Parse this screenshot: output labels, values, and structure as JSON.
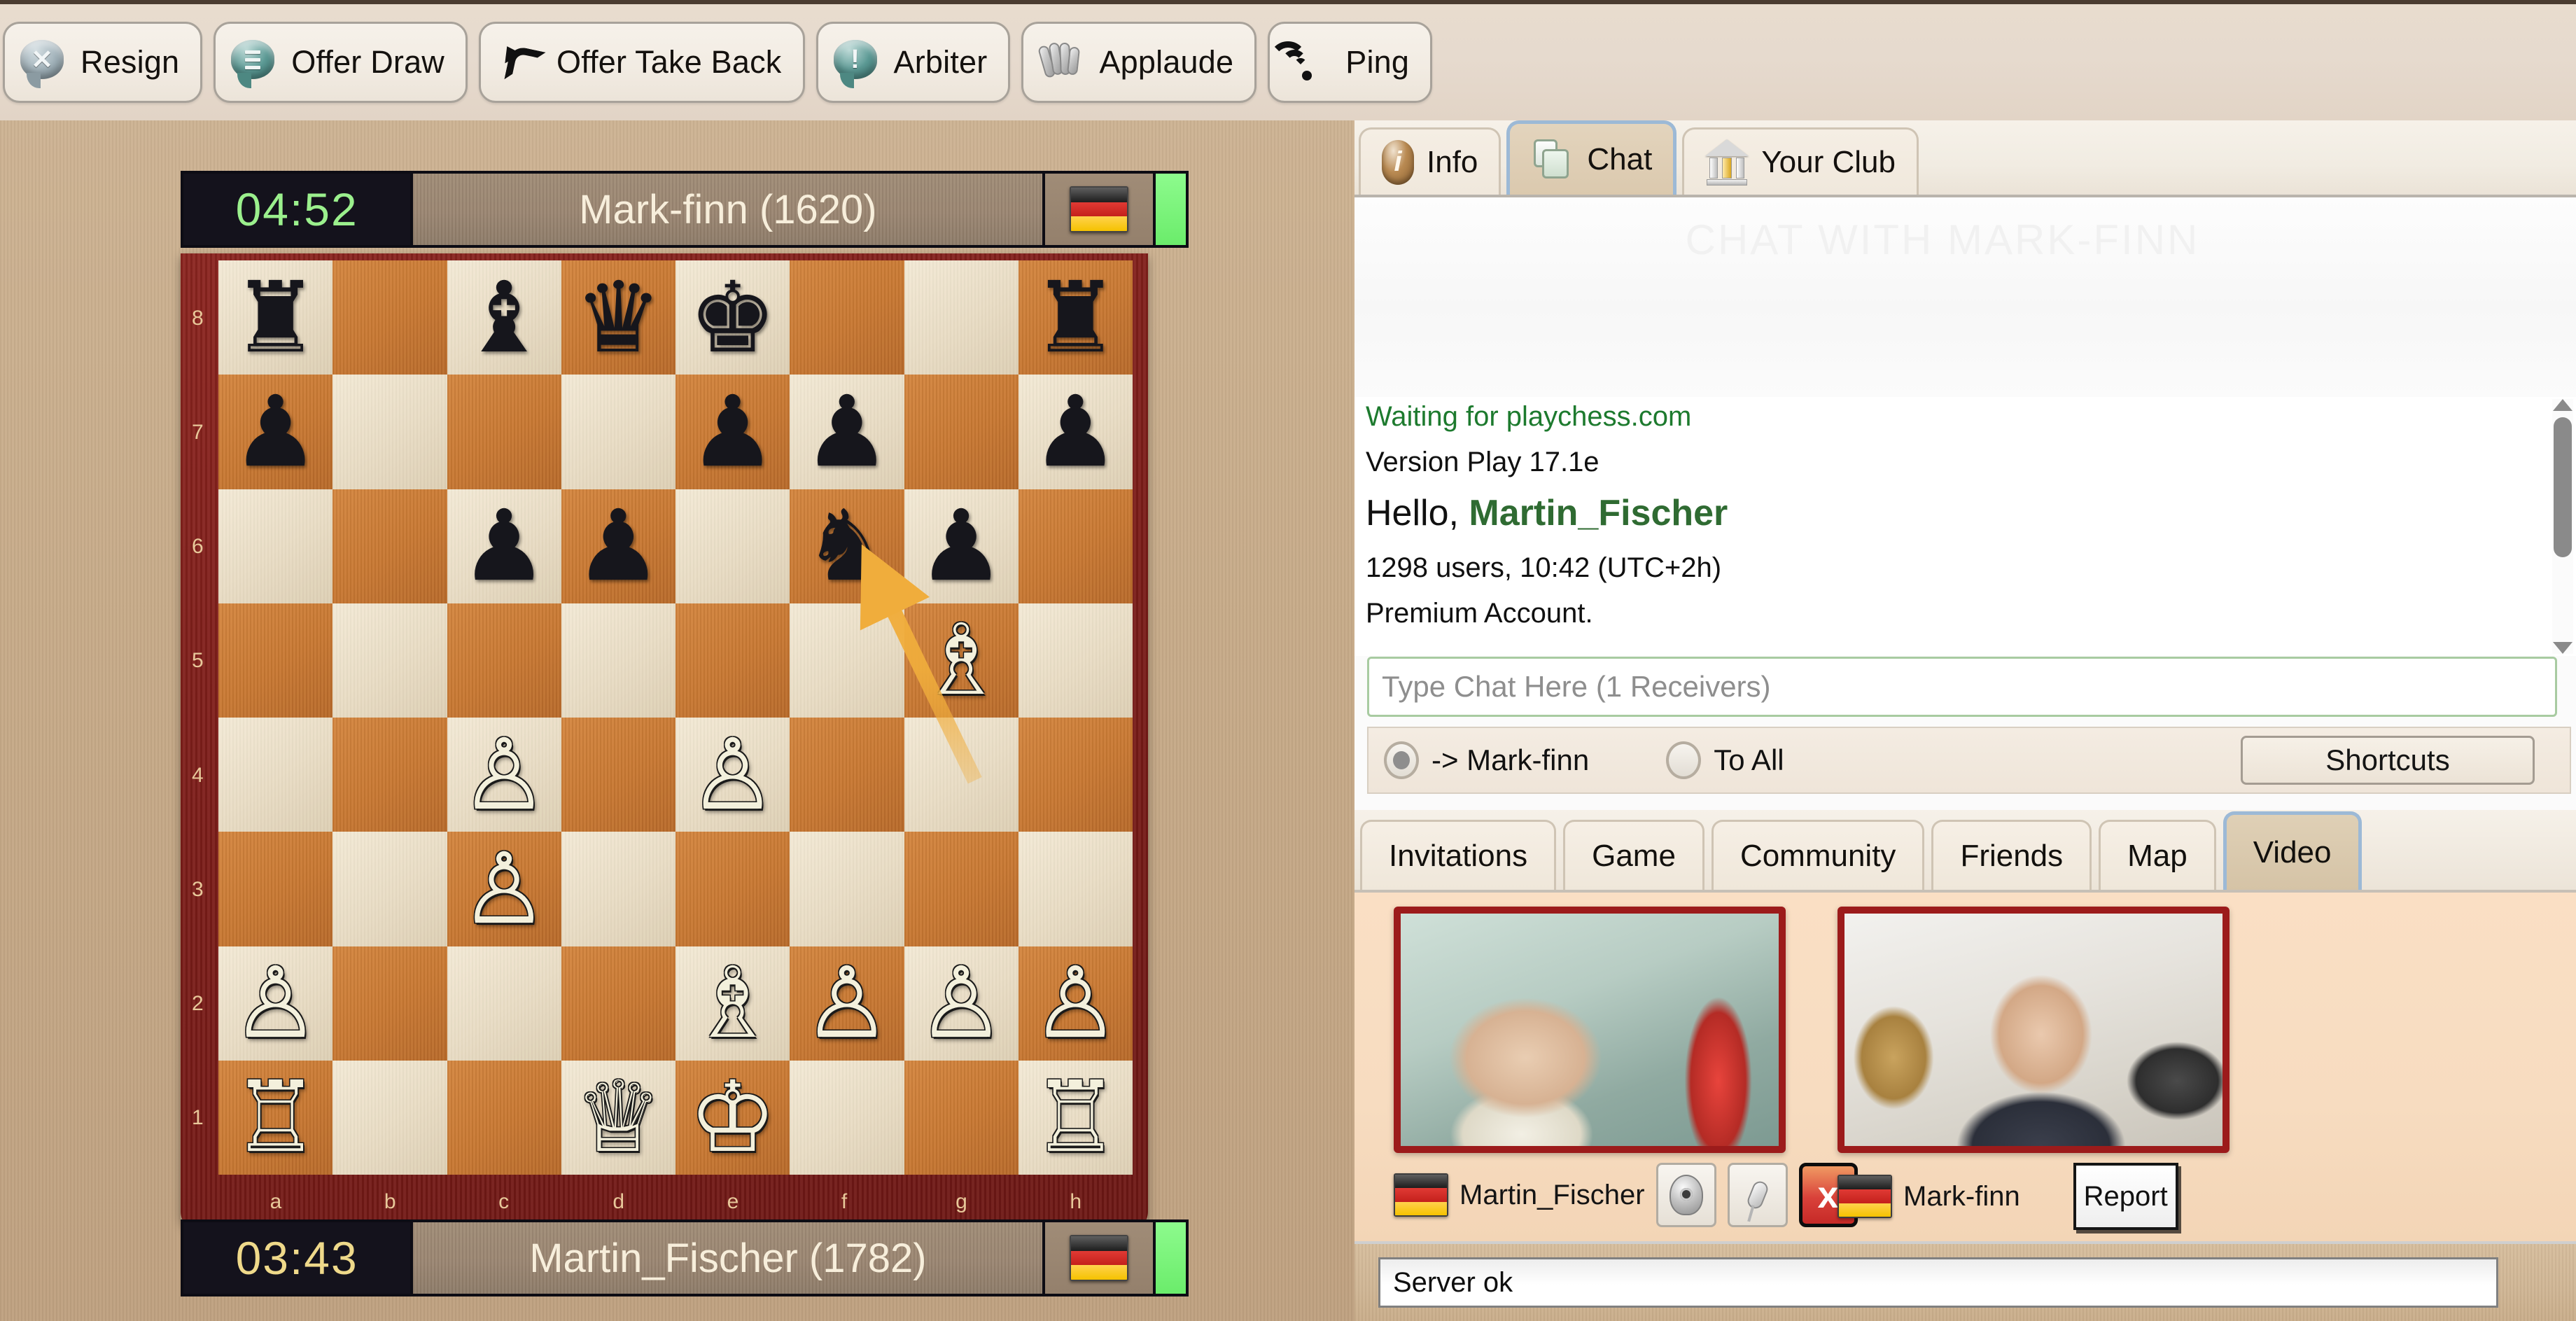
{
  "toolbar": {
    "buttons": [
      {
        "label": "Resign",
        "icon": "resign-bubble-icon"
      },
      {
        "label": "Offer Draw",
        "icon": "offer-draw-bubble-icon"
      },
      {
        "label": "Offer Take Back",
        "icon": "undo-arrow-icon"
      },
      {
        "label": "Arbiter",
        "icon": "arbiter-bubble-icon"
      },
      {
        "label": "Applaude",
        "icon": "applause-hands-icon"
      },
      {
        "label": "Ping",
        "icon": "wifi-ping-icon"
      }
    ]
  },
  "board": {
    "top_player": {
      "clock": "04:52",
      "name": "Mark-finn (1620)",
      "flag": "germany",
      "clock_color": "#9bf08d"
    },
    "bottom_player": {
      "clock": "03:43",
      "name": "Martin_Fischer (1782)",
      "flag": "germany",
      "clock_color": "#efd98a"
    },
    "files": [
      "a",
      "b",
      "c",
      "d",
      "e",
      "f",
      "g",
      "h"
    ],
    "ranks": [
      "8",
      "7",
      "6",
      "5",
      "4",
      "3",
      "2",
      "1"
    ],
    "orientation": "white-bottom",
    "arrow": {
      "from": "g5",
      "to": "f6",
      "color": "#f0ad3c"
    },
    "position": [
      [
        "br",
        "",
        "bb",
        "bq",
        "bk",
        "",
        "",
        "br"
      ],
      [
        "bp",
        "",
        "",
        "",
        "bp",
        "bp",
        "",
        "bp"
      ],
      [
        "",
        "",
        "bp",
        "bp",
        "",
        "bn",
        "bp",
        ""
      ],
      [
        "",
        "",
        "",
        "",
        "",
        "",
        "wb",
        ""
      ],
      [
        "",
        "",
        "wp",
        "",
        "wp",
        "",
        "",
        ""
      ],
      [
        "",
        "",
        "wp",
        "",
        "",
        "",
        "",
        ""
      ],
      [
        "wp",
        "",
        "",
        "",
        "wb",
        "wp",
        "wp",
        "wp"
      ],
      [
        "wr",
        "",
        "",
        "wq",
        "wk",
        "",
        "",
        "wr"
      ]
    ]
  },
  "right_panel": {
    "tabs": [
      {
        "label": "Info",
        "icon": "info-icon",
        "active": false
      },
      {
        "label": "Chat",
        "icon": "chat-icon",
        "active": true
      },
      {
        "label": "Your Club",
        "icon": "club-icon",
        "active": false
      }
    ],
    "watermark": "CHAT WITH MARK-FINN",
    "chat_lines": [
      {
        "text": "Waiting for playchess.com",
        "style": "green"
      },
      {
        "text": "Version Play 17.1e",
        "style": "normal"
      }
    ],
    "hello_prefix": "Hello, ",
    "hello_user": "Martin_Fischer",
    "chat_lines2": [
      {
        "text": "1298 users, 10:42 (UTC+2h)",
        "style": "normal"
      },
      {
        "text": "Premium Account.",
        "style": "normal"
      }
    ],
    "chat_input_placeholder": "Type Chat Here (1 Receivers)",
    "receiver_options": [
      {
        "label": "-> Mark-finn",
        "selected": true
      },
      {
        "label": "To All",
        "selected": false
      }
    ],
    "shortcuts_label": "Shortcuts",
    "sub_tabs": [
      {
        "label": "Invitations",
        "active": false
      },
      {
        "label": "Game",
        "active": false
      },
      {
        "label": "Community",
        "active": false
      },
      {
        "label": "Friends",
        "active": false
      },
      {
        "label": "Map",
        "active": false
      },
      {
        "label": "Video",
        "active": true
      }
    ],
    "video": {
      "cells": [
        {
          "name": "Martin_Fischer",
          "flag": "germany",
          "controls": [
            {
              "icon": "webcam-icon",
              "label": ""
            },
            {
              "icon": "microphone-icon",
              "label": ""
            },
            {
              "icon": "close-x-icon",
              "label": "x"
            }
          ]
        },
        {
          "name": "Mark-finn",
          "flag": "germany",
          "controls": [
            {
              "icon": "report-button",
              "label": "Report"
            }
          ]
        }
      ]
    },
    "status_text": "Server ok"
  },
  "colors": {
    "accent_green": "#1d7a2e",
    "video_border": "#9c1b1b",
    "board_light": "#ece0c8",
    "board_dark": "#c87832",
    "board_frame": "#7a1c18",
    "toolbar_bg": "#e6dace"
  }
}
